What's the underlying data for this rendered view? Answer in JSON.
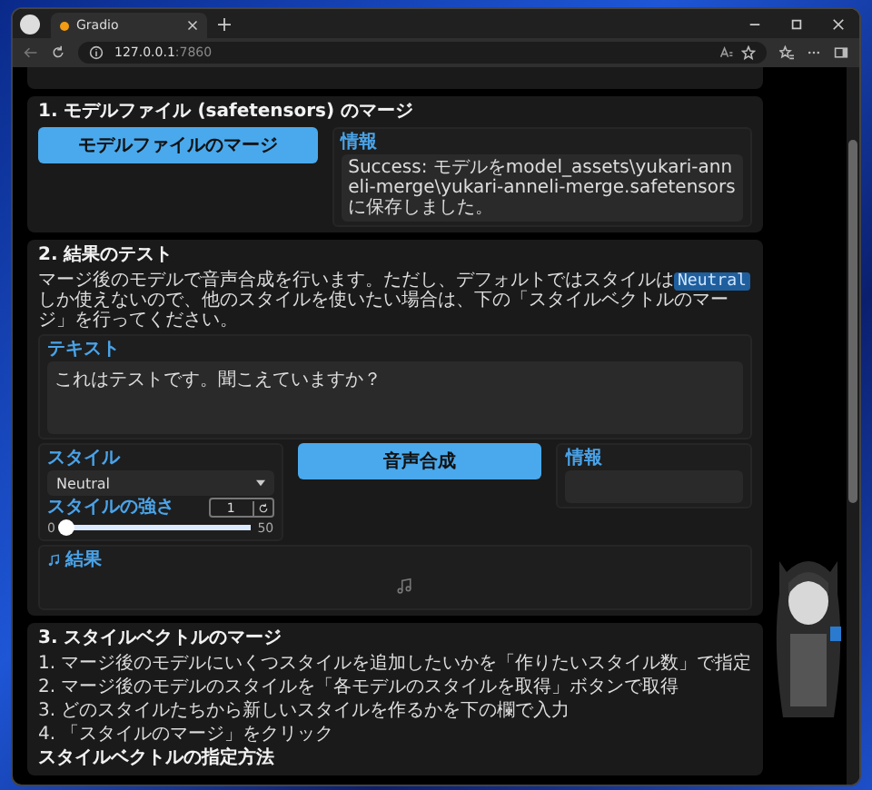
{
  "browser": {
    "tab_title": "Gradio",
    "url_host": "127.0.0.1",
    "url_port": ":7860"
  },
  "merge_model": {
    "heading": "1. モデルファイル (safetensors) のマージ",
    "button": "モデルファイルのマージ",
    "info_label": "情報",
    "info_value": "Success: モデルをmodel_assets\\yukari-anneli-merge\\yukari-anneli-merge.safetensorsに保存しました。"
  },
  "test": {
    "heading": "2. 結果のテスト",
    "description_before": "マージ後のモデルで音声合成を行います。ただし、デフォルトではスタイルは",
    "description_code": "Neutral",
    "description_after": "しか使えないので、他のスタイルを使いたい場合は、下の「スタイルベクトルのマージ」を行ってください。",
    "text_label": "テキスト",
    "text_value": "これはテストです。聞こえていますか？",
    "style_label": "スタイル",
    "style_value": "Neutral",
    "strength_label": "スタイルの強さ",
    "strength_value": "1",
    "slider_min": "0",
    "slider_max": "50",
    "slider": {
      "level": 0.02
    },
    "synth_button": "音声合成",
    "info_label": "情報",
    "result_label": "結果"
  },
  "style_merge": {
    "heading": "3. スタイルベクトルのマージ",
    "steps": [
      "1. マージ後のモデルにいくつスタイルを追加したいかを「作りたいスタイル数」で指定",
      "2. マージ後のモデルのスタイルを「各モデルのスタイルを取得」ボタンで取得",
      "3. どのスタイルたちから新しいスタイルを作るかを下の欄で入力",
      "4. 「スタイルのマージ」をクリック"
    ],
    "subheading": "スタイルベクトルの指定方法"
  }
}
